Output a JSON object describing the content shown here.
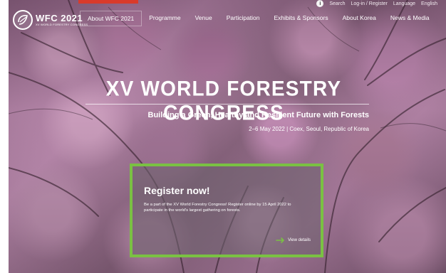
{
  "site": {
    "logo_main": "WFC 2021",
    "logo_sub": "XV WORLD FORESTRY CONGRESS",
    "utility": [
      "Search",
      "Log-in / Register",
      "Language",
      "English"
    ]
  },
  "nav": [
    "About WFC 2021",
    "Programme",
    "Venue",
    "Participation",
    "Exhibits & Sponsors",
    "About Korea",
    "News & Media"
  ],
  "hero": {
    "title": "XV WORLD FORESTRY CONGRESS",
    "subtitle": "Building a Green, Healthy and Resilient Future with Forests",
    "meta": "2–6 May 2022 | Coex, Seoul, Republic of Korea"
  },
  "register": {
    "title": "Register now!",
    "text": "Be a part of the XV World Forestry Congress! Register online by 15 April 2022 to participate in the world's largest gathering on forests.",
    "cta": "View details"
  },
  "colors": {
    "accent": "#7ac143",
    "brand_red": "#d93a2b"
  },
  "icons": {
    "logo": "wfc-leaf-logo-icon",
    "arrow": "arrow-right-icon",
    "info": "info-icon"
  }
}
